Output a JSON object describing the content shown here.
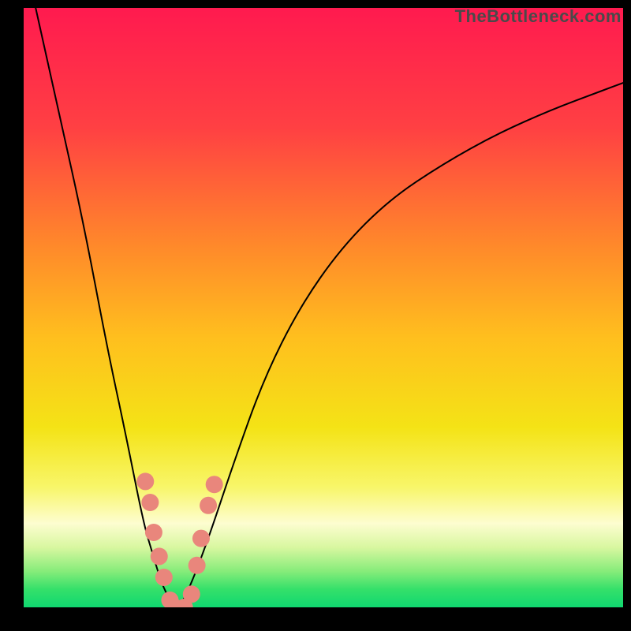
{
  "watermark": "TheBottleneck.com",
  "chart_data": {
    "type": "line",
    "title": "",
    "xlabel": "",
    "ylabel": "",
    "xlim": [
      0,
      1
    ],
    "ylim": [
      0,
      1
    ],
    "grid": false,
    "legend": false,
    "background_gradient": {
      "type": "vertical",
      "stops": [
        {
          "offset": 0.0,
          "color": "#ff1a4f"
        },
        {
          "offset": 0.2,
          "color": "#ff4043"
        },
        {
          "offset": 0.4,
          "color": "#ff8a2a"
        },
        {
          "offset": 0.55,
          "color": "#ffbf1e"
        },
        {
          "offset": 0.7,
          "color": "#f4e316"
        },
        {
          "offset": 0.8,
          "color": "#f8f66a"
        },
        {
          "offset": 0.86,
          "color": "#fdfdd0"
        },
        {
          "offset": 0.9,
          "color": "#d8f7a0"
        },
        {
          "offset": 0.94,
          "color": "#86ec7a"
        },
        {
          "offset": 0.97,
          "color": "#34e06a"
        },
        {
          "offset": 1.0,
          "color": "#10d870"
        }
      ]
    },
    "series": [
      {
        "name": "left-branch",
        "x": [
          0.02,
          0.06,
          0.1,
          0.14,
          0.17,
          0.2,
          0.215,
          0.23,
          0.245,
          0.25
        ],
        "values": [
          1.0,
          0.82,
          0.64,
          0.43,
          0.29,
          0.14,
          0.09,
          0.04,
          0.01,
          0.0
        ],
        "color": "#000000",
        "linewidth": 2
      },
      {
        "name": "right-branch",
        "x": [
          0.26,
          0.28,
          0.31,
          0.35,
          0.4,
          0.46,
          0.53,
          0.61,
          0.7,
          0.79,
          0.88,
          0.96,
          1.0
        ],
        "values": [
          0.0,
          0.04,
          0.12,
          0.24,
          0.38,
          0.5,
          0.6,
          0.68,
          0.74,
          0.79,
          0.83,
          0.86,
          0.875
        ],
        "color": "#000000",
        "linewidth": 2
      }
    ],
    "markers": {
      "color": "#e9867c",
      "radius_px": 11,
      "points": [
        {
          "x": 0.203,
          "y": 0.21
        },
        {
          "x": 0.211,
          "y": 0.175
        },
        {
          "x": 0.217,
          "y": 0.125
        },
        {
          "x": 0.226,
          "y": 0.085
        },
        {
          "x": 0.234,
          "y": 0.05
        },
        {
          "x": 0.244,
          "y": 0.012
        },
        {
          "x": 0.252,
          "y": 0.0
        },
        {
          "x": 0.268,
          "y": 0.0
        },
        {
          "x": 0.28,
          "y": 0.022
        },
        {
          "x": 0.289,
          "y": 0.07
        },
        {
          "x": 0.296,
          "y": 0.115
        },
        {
          "x": 0.308,
          "y": 0.17
        },
        {
          "x": 0.318,
          "y": 0.205
        }
      ]
    }
  }
}
